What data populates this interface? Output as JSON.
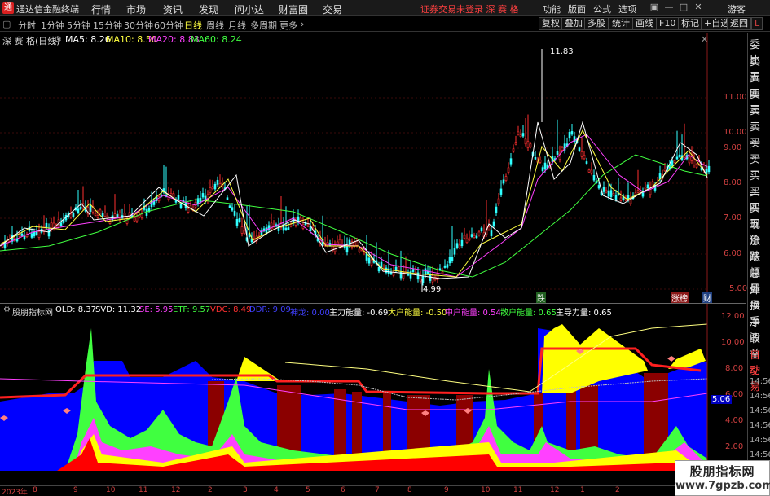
{
  "titlebar": {
    "app_name": "通达信金融终端",
    "menu": [
      "行情",
      "市场",
      "资讯",
      "发现",
      "问小达",
      "财富圈",
      "交易"
    ],
    "warning": "证券交易未登录 深 赛 格",
    "right_menu": [
      "功能",
      "版面",
      "公式",
      "选项"
    ],
    "guest": "游客"
  },
  "periods": {
    "items": [
      "分时",
      "1分钟",
      "5分钟",
      "15分钟",
      "30分钟",
      "60分钟",
      "日线",
      "周线",
      "月线",
      "多周期",
      "更多"
    ],
    "active": "日线"
  },
  "toolbar": [
    "复权",
    "叠加",
    "多股",
    "统计",
    "画线",
    "F10",
    "标记",
    "+自选",
    "返回"
  ],
  "main_chart": {
    "stock_title": "深 赛 格(日线)",
    "ma": [
      {
        "label": "MA5: 8.26",
        "color": "#ffffff"
      },
      {
        "label": "MA10: 8.50",
        "color": "#ffff40"
      },
      {
        "label": "MA20: 8.83",
        "color": "#ff40ff"
      },
      {
        "label": "MA60: 8.24",
        "color": "#40ff40"
      }
    ],
    "y_ticks": [
      "11.00",
      "10.00",
      "9.00",
      "8.00",
      "7.00",
      "6.00",
      "5.00"
    ],
    "high_label": "11.83",
    "low_label": "4.99",
    "markers": {
      "die": "跌",
      "zhangbang": "涨榜",
      "cai": "财"
    }
  },
  "right_panel": [
    "委比",
    "卖五",
    "卖四",
    "卖三",
    "卖二",
    "卖一",
    "买一",
    "买二",
    "买三",
    "买四",
    "买五",
    "现价",
    "涨跌",
    "涨幅",
    "总量",
    "外盘",
    "换手",
    "净资",
    "收益",
    "自动",
    "交易"
  ],
  "indicator": {
    "name": "股朋指标网",
    "values": [
      {
        "label": "OLD: 8.37",
        "color": "#ffffff"
      },
      {
        "label": "SVD: 11.32",
        "color": "#ffffff"
      },
      {
        "label": "SE: 5.95",
        "color": "#ff40ff"
      },
      {
        "label": "ETF: 9.57",
        "color": "#40ff40"
      },
      {
        "label": "VDC: 8.49",
        "color": "#ff3030"
      },
      {
        "label": "DDR: 9.09",
        "color": "#4040ff"
      },
      {
        "label": "神龙: 0.00",
        "color": "#4040ff"
      },
      {
        "label": "主力能量: -0.69",
        "color": "#ffffff"
      },
      {
        "label": "大户能量: -0.50",
        "color": "#ffff40"
      },
      {
        "label": "中户能量: 0.54",
        "color": "#ff40ff"
      },
      {
        "label": "散户能量: 0.65",
        "color": "#40ff40"
      },
      {
        "label": "主导力量: 0.65",
        "color": "#ffffff"
      }
    ],
    "y_ticks": [
      "12.00",
      "10.00",
      "8.00",
      "6.00",
      "4.00",
      "2.00"
    ],
    "current_value": "5.06",
    "right_times": [
      "14:56",
      "14:56",
      "14:56",
      "14:56",
      "14:56",
      "14:56",
      "14:56",
      "14:56",
      "14:56"
    ]
  },
  "time_axis": [
    "2023年",
    "8",
    "9",
    "10",
    "11",
    "12",
    "2",
    "3",
    "4",
    "5",
    "6",
    "7",
    "8",
    "9",
    "10",
    "11",
    "12",
    "1",
    "2"
  ],
  "watermark": {
    "line1": "股朋指标网",
    "line2": "www.7gpzb.com"
  }
}
